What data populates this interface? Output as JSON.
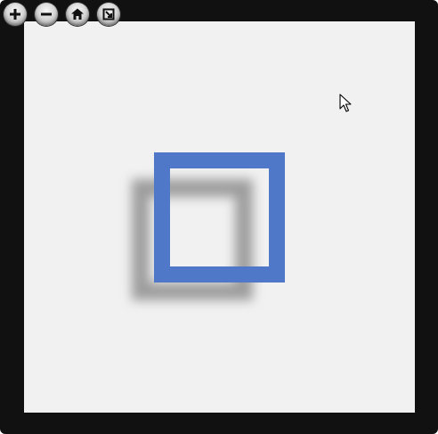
{
  "viewer": {
    "toolbar": {
      "buttons": [
        {
          "icon": "zoom-in-icon",
          "glyph": "+"
        },
        {
          "icon": "zoom-out-icon",
          "glyph": "−"
        },
        {
          "icon": "home-icon",
          "glyph": "⌂"
        },
        {
          "icon": "fullscreen-icon",
          "glyph": "⤢"
        }
      ]
    },
    "canvas": {
      "background": "#f1f1f1",
      "shape": {
        "type": "square-outline",
        "color": "#5078c8",
        "shadow": true
      }
    },
    "colors": {
      "frame": "#111111",
      "accent": "#5078c8"
    }
  }
}
